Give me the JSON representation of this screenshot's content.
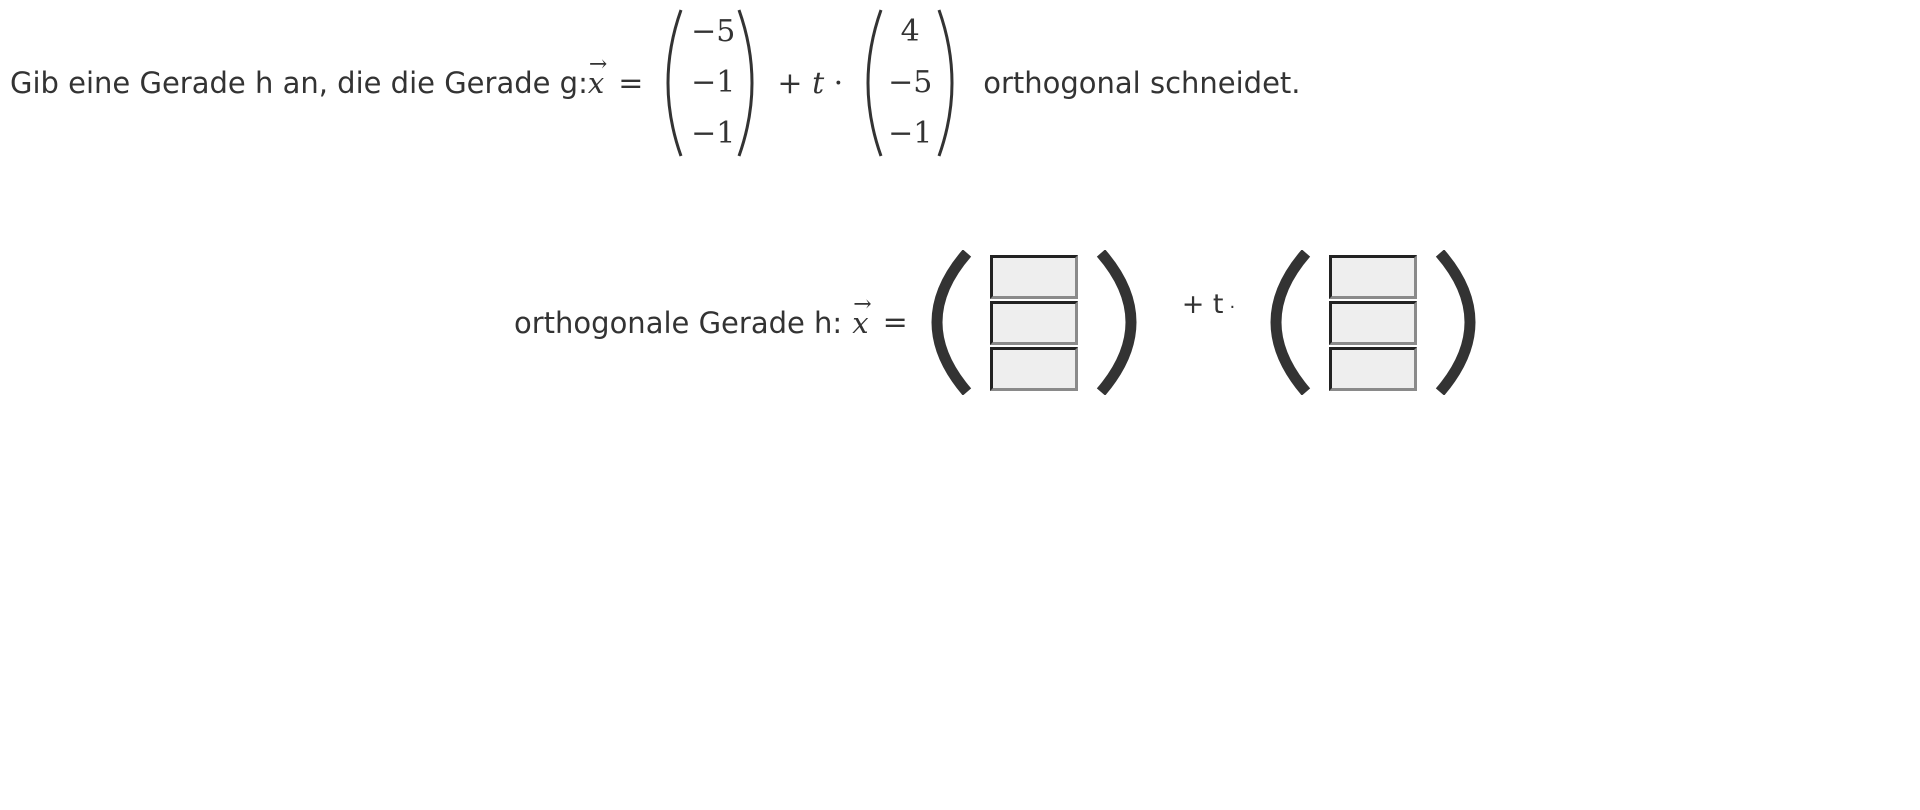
{
  "question": {
    "prefix": "Gib eine Gerade h an, die die Gerade g:",
    "x_symbol": "x",
    "equals": "=",
    "vector1": [
      "−5",
      "−1",
      "−1"
    ],
    "plus": "+",
    "param": "t",
    "dot": "·",
    "vector2": [
      "4",
      "−5",
      "−1"
    ],
    "suffix": "orthogonal schneidet."
  },
  "answer": {
    "label": "orthogonale Gerade h:",
    "x_symbol": "x",
    "equals": "=",
    "plus_t": "+ t",
    "dot": "·",
    "support_vector": [
      "",
      "",
      ""
    ],
    "direction_vector": [
      "",
      "",
      ""
    ]
  }
}
